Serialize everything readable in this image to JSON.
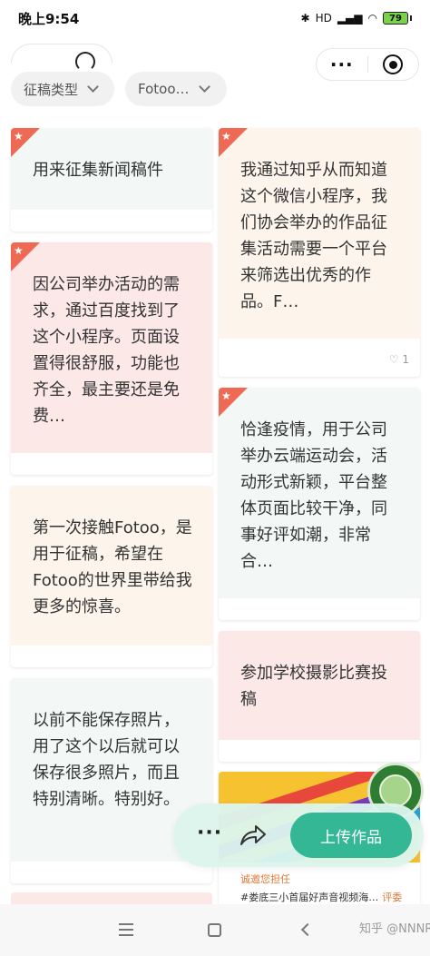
{
  "status_bar": {
    "time": "晚上9:54",
    "signal": "HD",
    "battery": "79"
  },
  "filters": [
    {
      "label": "征稿类型"
    },
    {
      "label": "Fotoo…"
    }
  ],
  "cards": [
    {
      "text": "用来征集新闻稿件",
      "featured": true
    },
    {
      "text": "我通过知乎从而知道这个微信小程序，我们协会举办的作品征集活动需要一个平台来筛选出优秀的作品。F…",
      "featured": true,
      "likes": "1"
    },
    {
      "text": "因公司举办活动的需求，通过百度找到了这个小程序。页面设置得很舒服，功能也齐全，最主要还是免费…",
      "featured": true
    },
    {
      "text": "恰逢疫情，用于公司举办云端运动会，活动形式新颖，平台整体页面比较干净，同事好评如潮，非常合…",
      "featured": true
    },
    {
      "text": "第一次接触Fotoo，是用于征稿，希望在Fotoo的世界里带给我更多的惊喜。",
      "featured": false
    },
    {
      "text": "参加学校摄影比赛投稿",
      "featured": false
    },
    {
      "text": "以前不能保存照片，用了这个以后就可以保存很多照片，而且特别清晰。特别好。",
      "featured": false
    }
  ],
  "image_card": {
    "subtitle": "诚邀您担任",
    "title": "#娄底三小首届好声音视频海…",
    "tag": "评委"
  },
  "actions": {
    "more": "···",
    "upload": "上传作品"
  },
  "icons": {
    "badge": "star-icon",
    "like": "heart-icon",
    "share": "share-icon"
  },
  "colors": {
    "accent": "#33b795",
    "badge": "#ef6a55",
    "mint": "#f3f8f7",
    "pink": "#fde8e8",
    "cream": "#fdf4ec"
  },
  "watermark": "知乎 @NNNR"
}
